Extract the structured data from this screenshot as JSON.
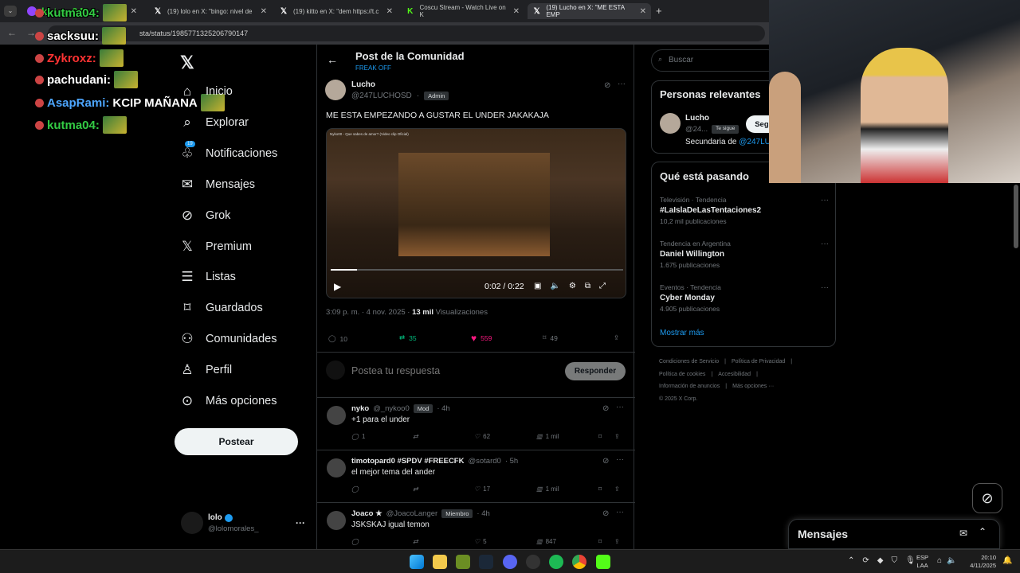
{
  "browser": {
    "tabs": [
      {
        "title": "kutma04:",
        "icon": "twitch-icon",
        "active": false
      },
      {
        "title": "(19) lolo en X: \"bingo: nivel de",
        "icon": "x-logo-icon",
        "active": false
      },
      {
        "title": "(19) kitto en X: \"dem https://t.c",
        "icon": "x-logo-icon",
        "active": false
      },
      {
        "title": "Coscu Stream - Watch Live on K",
        "icon": "kick-icon",
        "active": false
      },
      {
        "title": "(19) Lucho en X: \"ME ESTA EMP",
        "icon": "x-logo-icon",
        "active": true
      }
    ],
    "url": "sta/status/1985771325206790147"
  },
  "chat": [
    {
      "user": "kutma04:",
      "message": "",
      "color": "#33cc44"
    },
    {
      "user": "sacksuu:",
      "message": "",
      "color": "#ffffff"
    },
    {
      "user": "Zykroxz:",
      "message": "",
      "color": "#ff3333"
    },
    {
      "user": "pachudani:",
      "message": "",
      "color": "#ffffff"
    },
    {
      "user": "AsapRami:",
      "message": "KCIP MAÑANA",
      "color": "#4da6ff"
    },
    {
      "user": "kutma04:",
      "message": "",
      "color": "#33cc44"
    }
  ],
  "sidebar": {
    "items": [
      {
        "label": "Inicio",
        "icon": "home-icon"
      },
      {
        "label": "Explorar",
        "icon": "search-icon"
      },
      {
        "label": "Notificaciones",
        "icon": "bell-icon",
        "badge": "19"
      },
      {
        "label": "Mensajes",
        "icon": "mail-icon"
      },
      {
        "label": "Grok",
        "icon": "grok-icon"
      },
      {
        "label": "Premium",
        "icon": "x-logo-icon"
      },
      {
        "label": "Listas",
        "icon": "list-icon"
      },
      {
        "label": "Guardados",
        "icon": "bookmark-icon"
      },
      {
        "label": "Comunidades",
        "icon": "people-icon"
      },
      {
        "label": "Perfil",
        "icon": "user-icon"
      },
      {
        "label": "Más opciones",
        "icon": "more-circle-icon"
      }
    ],
    "post_button": "Postear",
    "account": {
      "name": "lolo",
      "handle": "@lolomorales_",
      "more": "···"
    }
  },
  "header": {
    "title": "Post de la Comunidad",
    "subtitle": "FREAK OFF"
  },
  "post": {
    "name": "Lucho",
    "handle": "@247LUCHOSD",
    "role": "Admin",
    "text": "ME ESTA EMPEZANDO A GUSTAR EL UNDER JAKAKAJA",
    "video": {
      "title": "Nyko00 - Que sabes de amor? (Video clip Oficial)",
      "time": "0:02 / 0:22",
      "progress": 0.09
    },
    "timestamp": "3:09 p. m. · 4 nov. 2025 · ",
    "views_count": "13 mil",
    "views_label": " Visualizaciones",
    "replies": "10",
    "reposts": "35",
    "likes": "559",
    "bookmarks": "49"
  },
  "reply_box": {
    "placeholder": "Postea tu respuesta",
    "button": "Responder"
  },
  "replies": [
    {
      "name": "nyko",
      "handle": "@_nykoo0",
      "role": "Mod",
      "time": "· 4h",
      "text": "+1 para el under",
      "replies": "1",
      "reposts": "",
      "likes": "62",
      "views": "1 mil"
    },
    {
      "name": "timotopard0 #SPDV #FREECFK",
      "handle": "@sotard0",
      "role": "",
      "time": "· 5h",
      "text": "el mejor tema del ander",
      "replies": "",
      "reposts": "",
      "likes": "17",
      "views": "1 mil"
    },
    {
      "name": "Joaco ★",
      "handle": "@JoacoLanger",
      "role": "Miembro",
      "time": "· 4h",
      "text": "JSKSKAJ igual temon",
      "replies": "",
      "reposts": "",
      "likes": "5",
      "views": "847"
    }
  ],
  "right": {
    "search_placeholder": "Buscar",
    "relevant_title": "Personas relevantes",
    "relevant": {
      "name": "Lucho",
      "handle": "@24...",
      "follows_you": "Te sigue",
      "follow_button": "Seguir",
      "bio_prefix": "Secundaria de ",
      "bio_link": "@247LU"
    },
    "trending_title": "Qué está pasando",
    "trends": [
      {
        "context": "Televisión · Tendencia",
        "name": "#LaIslaDeLasTentaciones2",
        "count": "10,2 mil publicaciones"
      },
      {
        "context": "Tendencia en Argentina",
        "name": "Daniel Willington",
        "count": "1.675 publicaciones"
      },
      {
        "context": "Eventos · Tendencia",
        "name": "Cyber Monday",
        "count": "4.905 publicaciones"
      }
    ],
    "show_more": "Mostrar más",
    "footer": [
      "Condiciones de Servicio",
      "|",
      "Política de Privacidad",
      "|",
      "Política de cookies",
      "|",
      "Accesibilidad",
      "|",
      "Información de anuncios",
      "|",
      "Más opciones ···",
      "© 2025 X Corp."
    ]
  },
  "messages_drawer": {
    "title": "Mensajes"
  },
  "taskbar": {
    "lang1": "ESP",
    "lang2": "LAA",
    "time": "20:10",
    "date": "4/11/2025"
  },
  "colors": {
    "accent": "#1d9bf0",
    "like": "#f91880",
    "repost": "#00ba7c",
    "bg": "#000000"
  }
}
